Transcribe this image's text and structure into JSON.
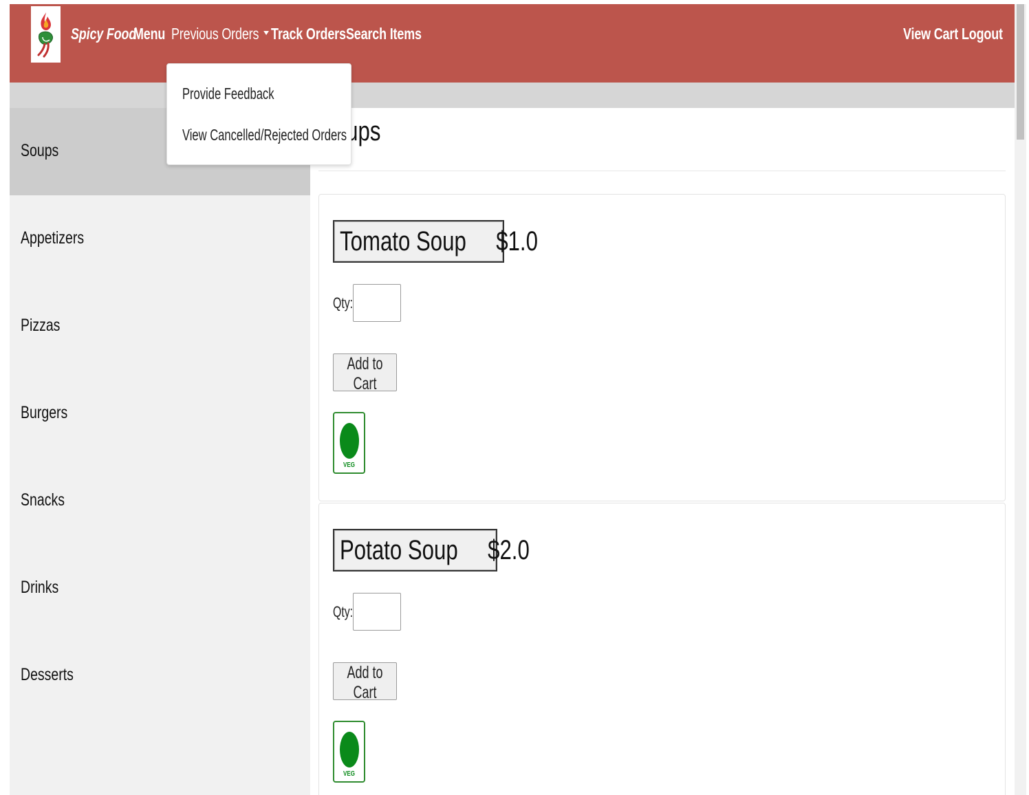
{
  "navbar": {
    "brand": "Spicy Food",
    "links": {
      "menu": "Menu",
      "previous_orders": "Previous Orders",
      "track_orders": "Track Orders",
      "search_items": "Search Items",
      "view_cart": "View Cart",
      "logout": "Logout"
    },
    "background_color": "#bc554c",
    "dropdown": {
      "items": [
        "Provide Feedback",
        "View Cancelled/Rejected Orders"
      ]
    }
  },
  "sidebar": {
    "items": [
      "Soups",
      "Appetizers",
      "Pizzas",
      "Burgers",
      "Snacks",
      "Drinks",
      "Desserts"
    ],
    "active": "Soups"
  },
  "main": {
    "heading": "Soups",
    "products": [
      {
        "name": "Tomato Soup",
        "price": "$1.0",
        "qty_label": "Qty:",
        "qty_value": "",
        "add_label": "Add to Cart",
        "badge": "VEG",
        "badge_color": "#0a8a1a"
      },
      {
        "name": "Potato Soup",
        "price": "$2.0",
        "qty_label": "Qty:",
        "qty_value": "",
        "add_label": "Add to Cart",
        "badge": "VEG",
        "badge_color": "#0a8a1a"
      }
    ]
  }
}
